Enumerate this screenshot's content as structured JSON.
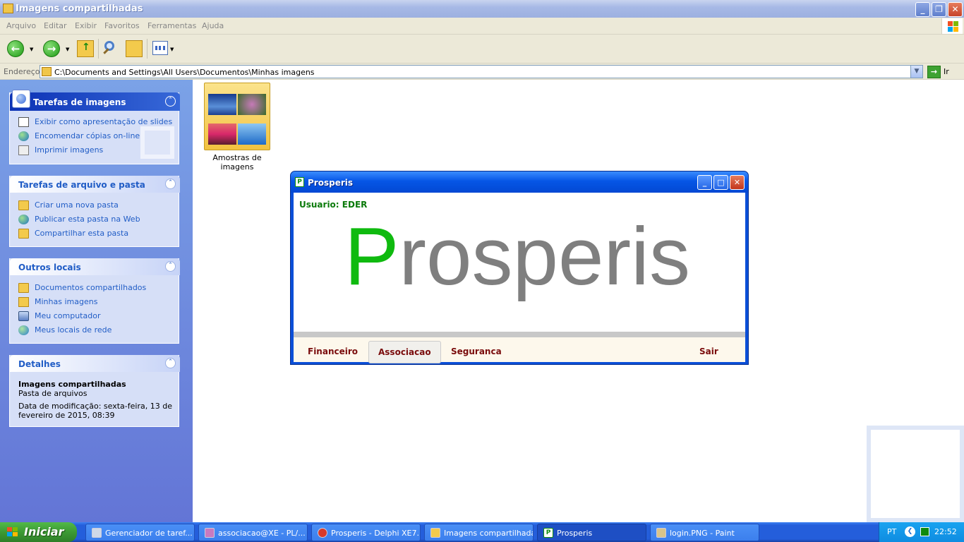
{
  "window": {
    "title": "Imagens compartilhadas",
    "controls": {
      "minimize": "_",
      "maximize": "❐",
      "close": "✕"
    }
  },
  "menu": [
    "Arquivo",
    "Editar",
    "Exibir",
    "Favoritos",
    "Ferramentas",
    "Ajuda"
  ],
  "toolbar": {
    "back_icon": "back-arrow-icon",
    "forward_icon": "forward-arrow-icon",
    "up_icon": "folder-up-icon",
    "search_icon": "search-icon",
    "folders_icon": "folders-icon",
    "views_icon": "views-icon"
  },
  "address": {
    "label": "Endereço",
    "path": "C:\\Documents and Settings\\All Users\\Documentos\\Minhas imagens",
    "go_label": "Ir"
  },
  "sidebar": {
    "image_tasks": {
      "title": "Tarefas de imagens",
      "items": [
        "Exibir como apresentação de slides",
        "Encomendar cópias on-line",
        "Imprimir imagens"
      ]
    },
    "file_tasks": {
      "title": "Tarefas de arquivo e pasta",
      "items": [
        "Criar uma nova pasta",
        "Publicar esta pasta na Web",
        "Compartilhar esta pasta"
      ]
    },
    "other_places": {
      "title": "Outros locais",
      "items": [
        "Documentos compartilhados",
        "Minhas imagens",
        "Meu computador",
        "Meus locais de rede"
      ]
    },
    "details": {
      "title": "Detalhes",
      "name": "Imagens compartilhadas",
      "type": "Pasta de arquivos",
      "modified": "Data de modificação: sexta-feira, 13 de fevereiro de 2015, 08:39"
    }
  },
  "content": {
    "folder_label": "Amostras de imagens"
  },
  "app": {
    "title": "Prosperis",
    "icon_letter": "P",
    "user": "Usuario: EDER",
    "logo_first": "P",
    "logo_rest": "rosperis",
    "menu": [
      "Financeiro",
      "Associacao",
      "Seguranca",
      "Sair"
    ],
    "selected_menu": "Associacao"
  },
  "taskbar": {
    "start_label": "Iniciar",
    "tasks": [
      "Gerenciador de taref...",
      "associacao@XE - PL/...",
      "Prosperis - Delphi XE7...",
      "Imagens compartilhadas",
      "Prosperis",
      "login.PNG - Paint"
    ],
    "active_task": "Prosperis",
    "language": "PT",
    "clock": "22:52"
  },
  "colors": {
    "xp_blue": "#245edb",
    "logo_green": "#0fba0f",
    "logo_gray": "#7f7f7f",
    "menu_red": "#7a0c0c",
    "sidebar_link": "#215dc6",
    "user_green": "#0a7a0a"
  }
}
